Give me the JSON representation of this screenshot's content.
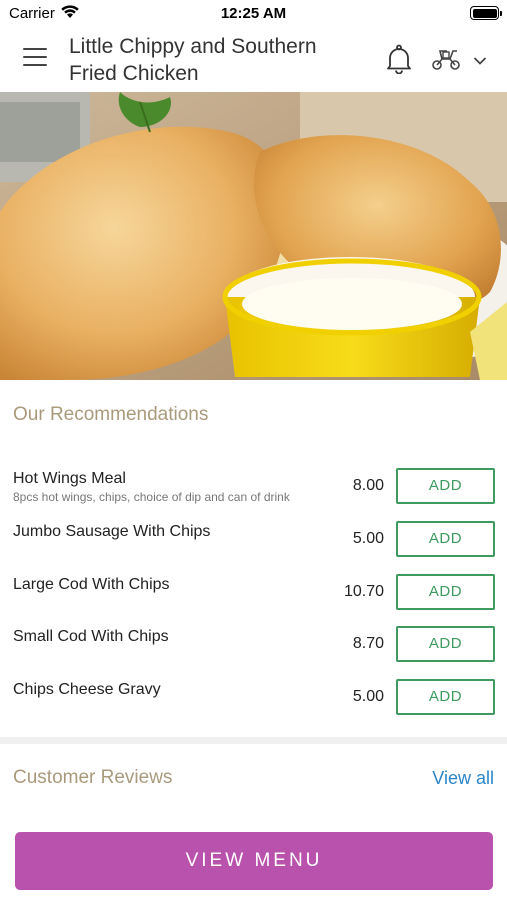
{
  "status_bar": {
    "carrier": "Carrier",
    "time": "12:25 AM",
    "icons": [
      "wifi-icon",
      "battery-icon"
    ]
  },
  "header": {
    "title": "Little Chippy and Southern Fried Chicken",
    "icons": [
      "menu-icon",
      "bell-icon",
      "scooter-icon",
      "chevron-down-icon"
    ]
  },
  "hero": {
    "image": "fried fish with chips and dip"
  },
  "recommendations": {
    "title": "Our Recommendations",
    "add_label": "ADD",
    "items": [
      {
        "name": "Hot Wings Meal",
        "description": "8pcs hot wings, chips, choice of dip and can of drink",
        "price": "8.00"
      },
      {
        "name": "Jumbo Sausage With Chips",
        "description": "",
        "price": "5.00"
      },
      {
        "name": "Large Cod With Chips",
        "description": "",
        "price": "10.70"
      },
      {
        "name": "Small Cod With Chips",
        "description": "",
        "price": "8.70"
      },
      {
        "name": "Chips Cheese Gravy",
        "description": "",
        "price": "5.00"
      }
    ]
  },
  "reviews": {
    "title": "Customer Reviews",
    "view_all": "View all"
  },
  "footer": {
    "button_label": "VIEW MENU"
  },
  "colors": {
    "section_title": "#a99a7c",
    "add_button": "#3e9a5e",
    "link": "#2a86c8",
    "primary_button": "#b852ad"
  }
}
